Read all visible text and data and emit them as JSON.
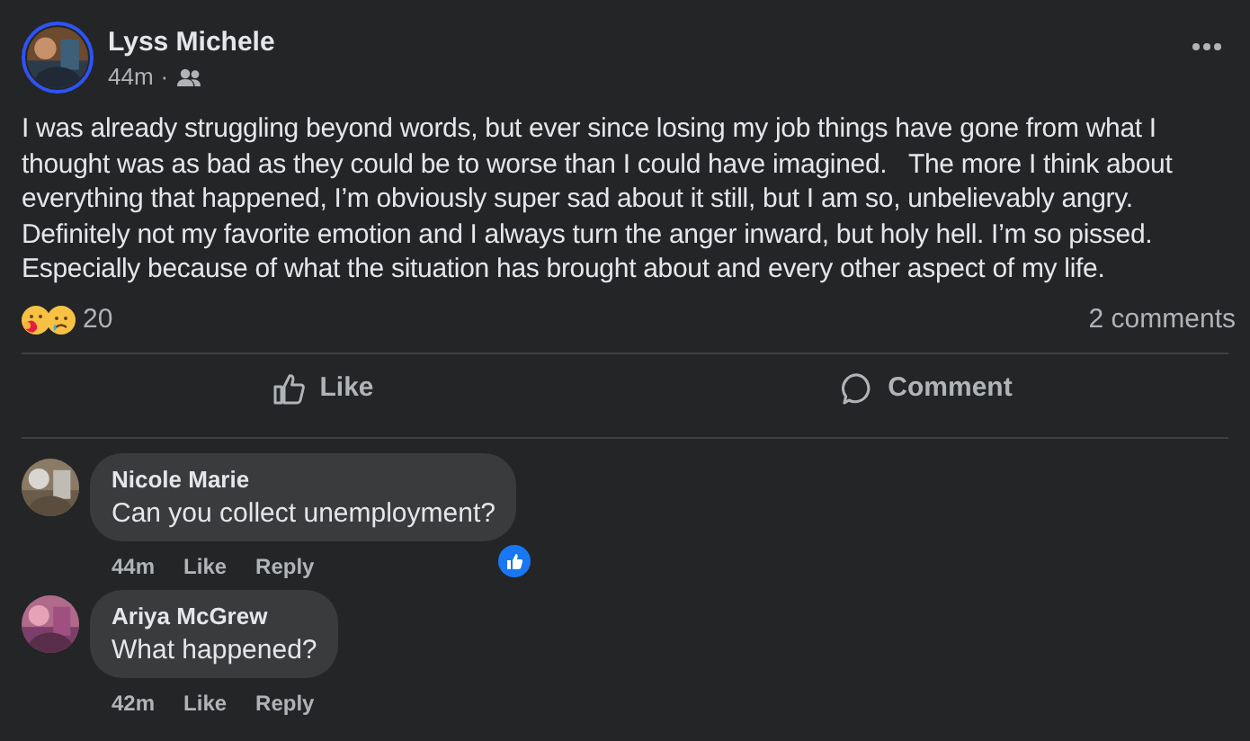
{
  "post": {
    "author": "Lyss Michele",
    "time": "44m",
    "separator": "·",
    "audience": {
      "kind": "friends"
    },
    "story_ring": true,
    "text": "I was already struggling beyond words, but ever since losing my job things have gone from what I thought was as bad as they could be to worse than I could have imagined.   The more I think about everything that happened, I’m obviously super sad about it still, but I am so, unbelievably angry. Definitely not my favorite emotion and I always turn the anger inward, but holy hell. I’m so pissed. Especially because of what the situation has brought about and every other aspect of my life.",
    "reactions": {
      "kinds": [
        {
          "kind": "care"
        },
        {
          "kind": "sad"
        }
      ],
      "count": "20"
    },
    "comments_count": "2 comments"
  },
  "actions": [
    {
      "kind": "like",
      "label": "Like"
    },
    {
      "kind": "comment",
      "label": "Comment"
    }
  ],
  "comments": [
    {
      "author": "Nicole Marie",
      "text": "Can you collect unemployment?",
      "time": "44m",
      "like": "Like",
      "reply": "Reply",
      "reaction": {
        "kind": "like"
      }
    },
    {
      "author": "Ariya McGrew",
      "text": "What happened?",
      "time": "42m",
      "like": "Like",
      "reply": "Reply"
    }
  ]
}
